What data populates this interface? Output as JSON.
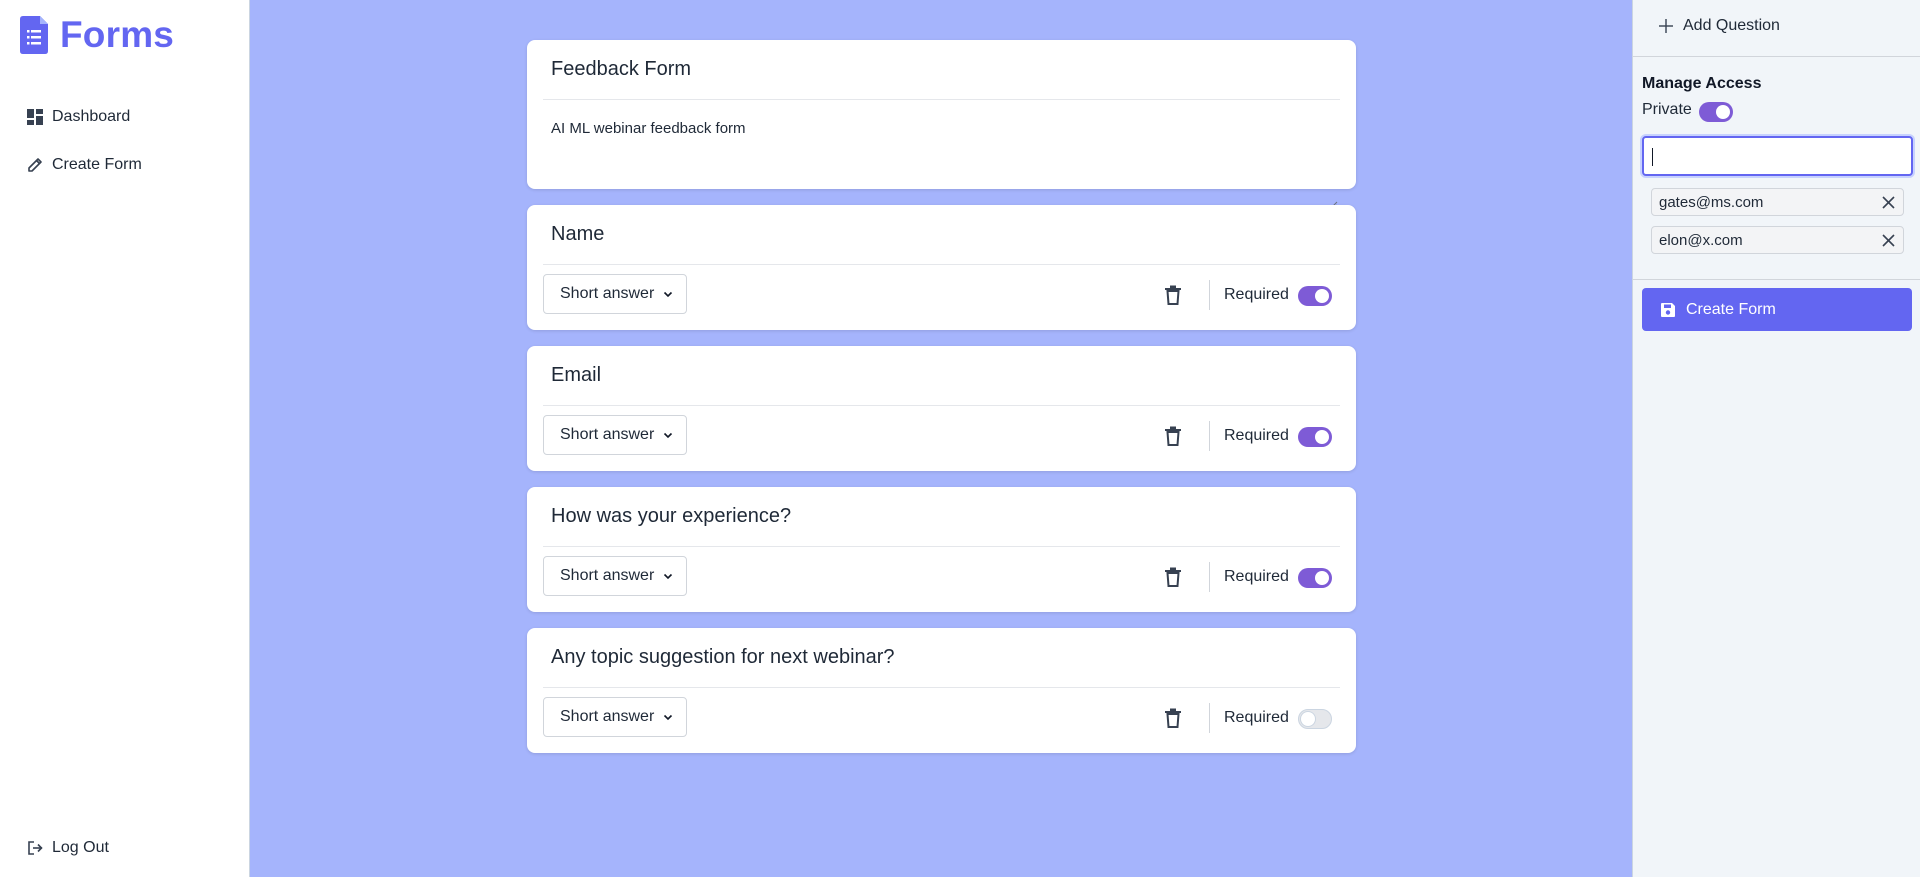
{
  "app": {
    "name": "Forms"
  },
  "sidebar": {
    "items": [
      {
        "label": "Dashboard",
        "icon": "dashboard-icon"
      },
      {
        "label": "Create Form",
        "icon": "pencil-icon"
      }
    ],
    "logout_label": "Log Out"
  },
  "form": {
    "title": "Feedback Form",
    "description": "AI ML webinar feedback form"
  },
  "questions": [
    {
      "title": "Name",
      "type": "Short answer",
      "required_label": "Required",
      "required": true
    },
    {
      "title": "Email",
      "type": "Short answer",
      "required_label": "Required",
      "required": true
    },
    {
      "title": "How was your experience?",
      "type": "Short answer",
      "required_label": "Required",
      "required": true
    },
    {
      "title": "Any topic suggestion for next webinar?",
      "type": "Short answer",
      "required_label": "Required",
      "required": false
    }
  ],
  "right_panel": {
    "add_question_label": "Add Question",
    "manage_access_title": "Manage Access",
    "private_label": "Private",
    "private_enabled": true,
    "email_input_value": "",
    "access_emails": [
      "gates@ms.com",
      "elon@x.com"
    ],
    "create_button_label": "Create Form"
  },
  "colors": {
    "accent": "#6366f1",
    "toggle_on": "#7e5bd6",
    "background": "#a5b4fc"
  }
}
